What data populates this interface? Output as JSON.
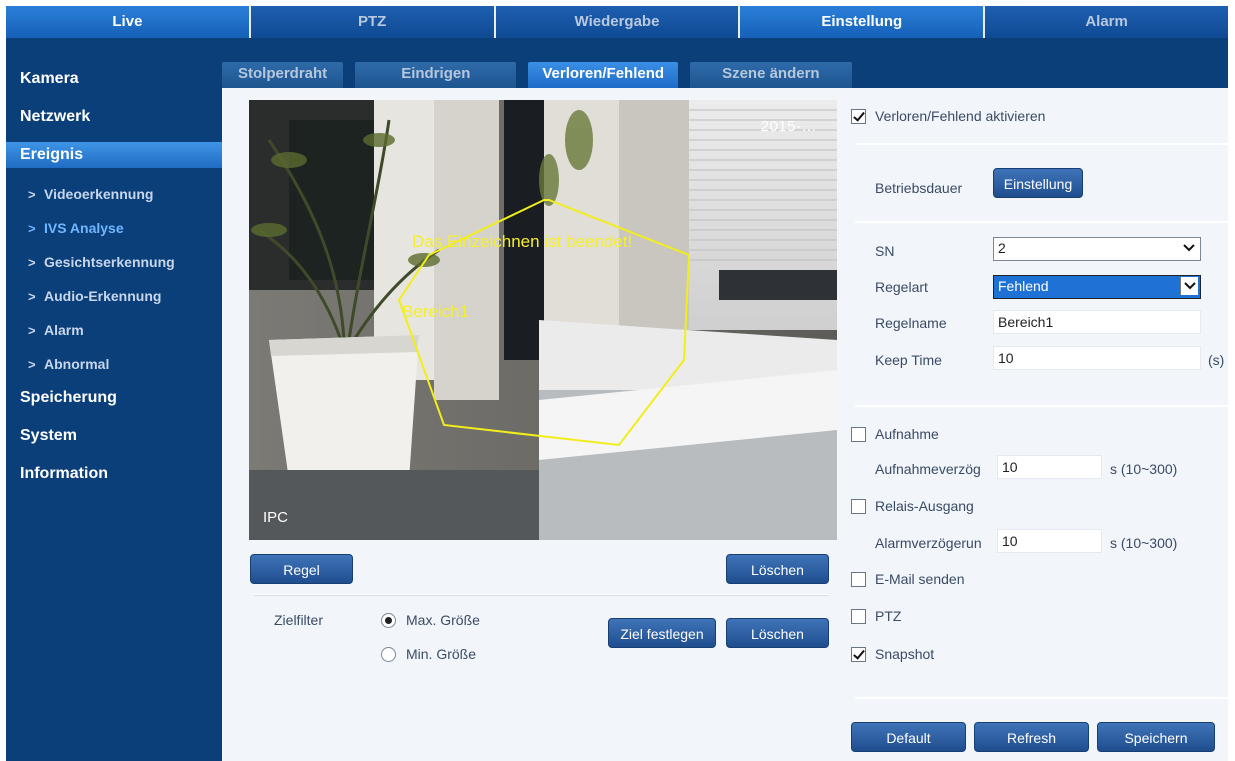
{
  "topnav": [
    "Live",
    "PTZ",
    "Wiedergabe",
    "Einstellung",
    "Alarm"
  ],
  "sidebar": {
    "kamera": "Kamera",
    "netzwerk": "Netzwerk",
    "ereignis": "Ereignis",
    "sub": [
      "Videoerkennung",
      "IVS Analyse",
      "Gesichtserkennung",
      "Audio-Erkennung",
      "Alarm",
      "Abnormal"
    ],
    "speicherung": "Speicherung",
    "system": "System",
    "information": "Information"
  },
  "subtabs": [
    "Stolperdraht",
    "Eindrigen",
    "Verloren/Fehlend",
    "Szene ändern"
  ],
  "video": {
    "timestamp": "2015-…",
    "ipc": "IPC",
    "drawing_done": "Das Einzeichnen ist beendet!",
    "region_label": "Bereich1"
  },
  "buttons": {
    "regel": "Regel",
    "loeschen1": "Löschen",
    "ziel": "Ziel festlegen",
    "loeschen2": "Löschen",
    "einstellung": "Einstellung",
    "default": "Default",
    "refresh": "Refresh",
    "speichern": "Speichern"
  },
  "zielfilter": {
    "label": "Zielfilter",
    "max": "Max. Größe",
    "min": "Min. Größe"
  },
  "settings": {
    "enable": "Verloren/Fehlend aktivieren",
    "betriebsdauer": "Betriebsdauer",
    "sn_label": "SN",
    "sn_value": "2",
    "regelart_label": "Regelart",
    "regelart_value": "Fehlend",
    "regelname_label": "Regelname",
    "regelname_value": "Bereich1",
    "keeptime_label": "Keep Time",
    "keeptime_value": "10",
    "keeptime_unit": "(s)",
    "aufnahme": "Aufnahme",
    "aufnahmeverz_label": "Aufnahmeverzög",
    "aufnahmeverz_value": "10",
    "aufnahmeverz_range": "s (10~300)",
    "relais": "Relais-Ausgang",
    "alarmverz_label": "Alarmverzögerun",
    "alarmverz_value": "10",
    "alarmverz_range": "s (10~300)",
    "email": "E-Mail senden",
    "ptz": "PTZ",
    "snapshot": "Snapshot"
  },
  "states": {
    "enable_checked": true,
    "aufnahme_checked": false,
    "relais_checked": false,
    "email_checked": false,
    "ptz_checked": false,
    "snapshot_checked": true,
    "zielfilter_selected": "max"
  }
}
